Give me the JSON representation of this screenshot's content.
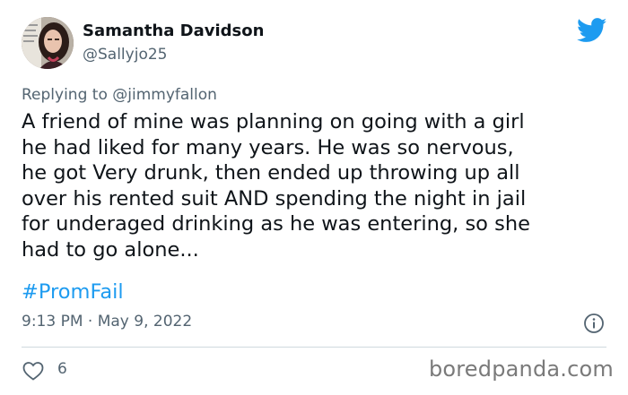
{
  "user": {
    "display_name": "Samantha Davidson",
    "handle": "@Sallyjo25"
  },
  "reply": {
    "prefix": "Replying to",
    "mention": "@jimmyfallon"
  },
  "tweet": {
    "text": "A friend of mine was planning on going with a girl\nhe had liked for many years. He was so nervous,\nhe got Very drunk, then ended up throwing up all\nover his rented suit AND spending the night in jail\nfor underaged drinking as he was entering, so she\nhad to go alone...",
    "hashtag": "#PromFail",
    "timestamp": "9:13 PM · May 9, 2022"
  },
  "engagement": {
    "likes": "6"
  },
  "watermark": "boredpanda.com",
  "icons": {
    "platform": "twitter-bird-icon",
    "info": "info-icon",
    "like": "heart-icon"
  },
  "colors": {
    "brand_blue": "#1d9bf0",
    "text_primary": "#0f1419",
    "text_secondary": "#536471",
    "divider": "#cfd9de"
  }
}
